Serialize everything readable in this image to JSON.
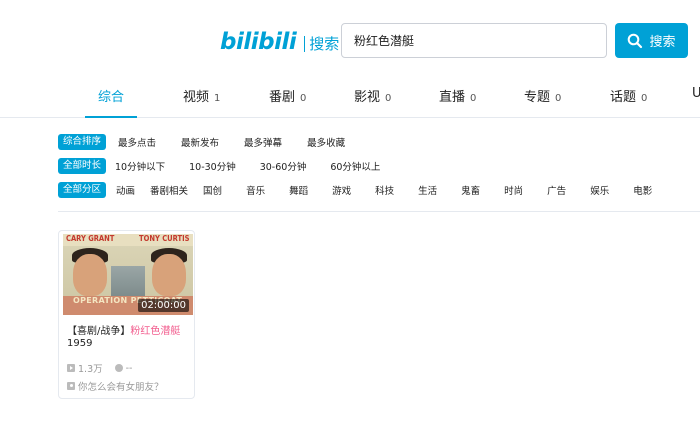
{
  "header": {
    "logo_text": "bilibili",
    "logo_subtitle": "搜索",
    "search_value": "粉红色潜艇",
    "search_button_label": "搜索"
  },
  "tabs": [
    {
      "label": "综合",
      "count": ""
    },
    {
      "label": "视频",
      "count": "1"
    },
    {
      "label": "番剧",
      "count": "0"
    },
    {
      "label": "影视",
      "count": "0"
    },
    {
      "label": "直播",
      "count": "0"
    },
    {
      "label": "专题",
      "count": "0"
    },
    {
      "label": "话题",
      "count": "0"
    },
    {
      "label": "U",
      "count": ""
    }
  ],
  "filters": {
    "sort": {
      "label": "综合排序",
      "options": [
        "最多点击",
        "最新发布",
        "最多弹幕",
        "最多收藏"
      ]
    },
    "duration": {
      "label": "全部时长",
      "options": [
        "10分钟以下",
        "10-30分钟",
        "30-60分钟",
        "60分钟以上"
      ]
    },
    "category": {
      "label": "全部分区",
      "options": [
        "动画",
        "番剧相关",
        "国创",
        "音乐",
        "舞蹈",
        "游戏",
        "科技",
        "生活",
        "鬼畜",
        "时尚",
        "广告",
        "娱乐",
        "电影"
      ]
    }
  },
  "result": {
    "thumb_cast_left": "CARY GRANT",
    "thumb_cast_right": "TONY CURTIS",
    "thumb_film_title": "OPERATION PETTICOAT",
    "duration": "02:00:00",
    "title_prefix": "【喜剧/战争】",
    "title_highlight": "粉红色潜艇",
    "year": "1959",
    "plays": "1.3万",
    "date": "--",
    "uploader": "你怎么会有女朋友？"
  },
  "colors": {
    "accent": "#00a1d6",
    "highlight": "#f25d8e"
  }
}
